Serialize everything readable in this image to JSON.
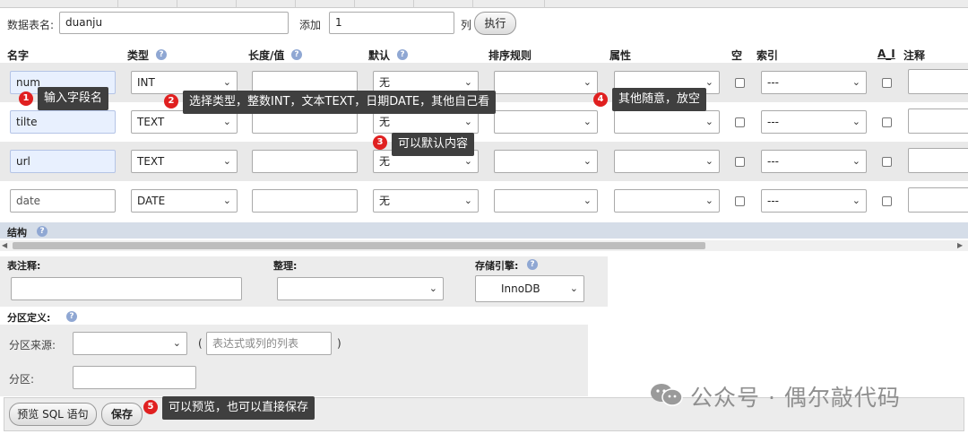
{
  "table_name": {
    "label": "数据表名:",
    "value": "duanju"
  },
  "add": {
    "label": "添加",
    "value": "1",
    "unit": "列",
    "execute_label": "执行"
  },
  "headers": {
    "name": "名字",
    "type": "类型",
    "length": "长度/值",
    "default": "默认",
    "collation": "排序规则",
    "attributes": "属性",
    "null": "空",
    "index": "索引",
    "ai": "A_I",
    "comment": "注释"
  },
  "rows": [
    {
      "name": "num",
      "type": "INT",
      "default": "无",
      "index": "---"
    },
    {
      "name": "tilte",
      "type": "TEXT",
      "default": "无",
      "index": "---"
    },
    {
      "name": "url",
      "type": "TEXT",
      "default": "无",
      "index": "---"
    },
    {
      "name": "date",
      "type": "DATE",
      "default": "无",
      "index": "---"
    }
  ],
  "structure_label": "结构",
  "table_comment_label": "表注释:",
  "collation_label": "整理:",
  "engine_label": "存储引擎:",
  "engine_value": "InnoDB",
  "partition": {
    "definition_label": "分区定义:",
    "source_label": "分区来源:",
    "expr_placeholder": "表达式或列的列表",
    "open_paren": "(",
    "close_paren": ")",
    "partitions_label": "分区:"
  },
  "buttons": {
    "preview_sql": "预览 SQL 语句",
    "save": "保存"
  },
  "annotations": [
    {
      "num": "1",
      "text": "输入字段名"
    },
    {
      "num": "2",
      "text": "选择类型，整数INT，文本TEXT，日期DATE，其他自己看"
    },
    {
      "num": "3",
      "text": "可以默认内容"
    },
    {
      "num": "4",
      "text": "其他随意，放空"
    },
    {
      "num": "5",
      "text": "可以预览，也可以直接保存"
    }
  ],
  "watermark": "公众号 · 偶尔敲代码",
  "help_glyph": "?",
  "colors": {
    "badge": "#e02020",
    "tooltip": "#3f3f3f",
    "structure_bar": "#d5dde8",
    "row_grey": "#e9e9e9",
    "focus_input": "#e8f0fe"
  }
}
